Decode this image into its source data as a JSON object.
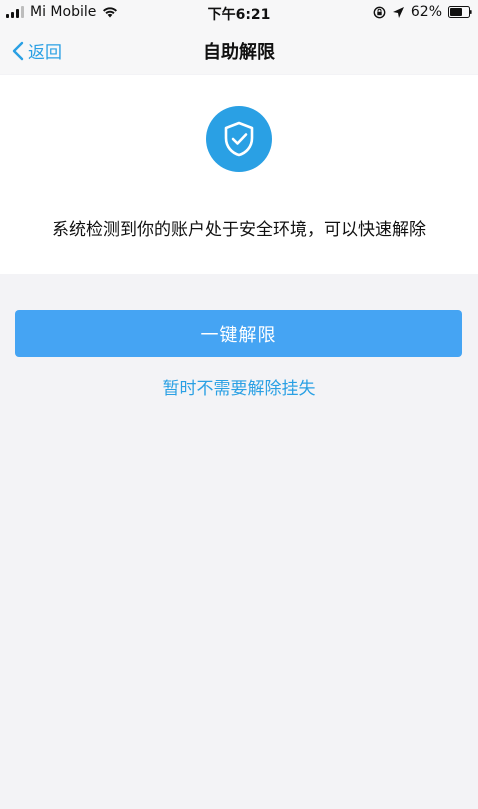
{
  "status_bar": {
    "carrier": "Mi Mobile",
    "time": "下午6:21",
    "battery": "62%"
  },
  "nav": {
    "back_label": "返回",
    "title": "自助解限"
  },
  "card": {
    "icon": "shield-check-icon",
    "message": "系统检测到你的账户处于安全环境，可以快速解除"
  },
  "actions": {
    "primary_label": "一键解限",
    "secondary_label": "暂时不需要解除挂失"
  },
  "colors": {
    "accent": "#2aa0e4",
    "button": "#45a4f3",
    "background": "#f3f3f6",
    "card": "#ffffff"
  }
}
